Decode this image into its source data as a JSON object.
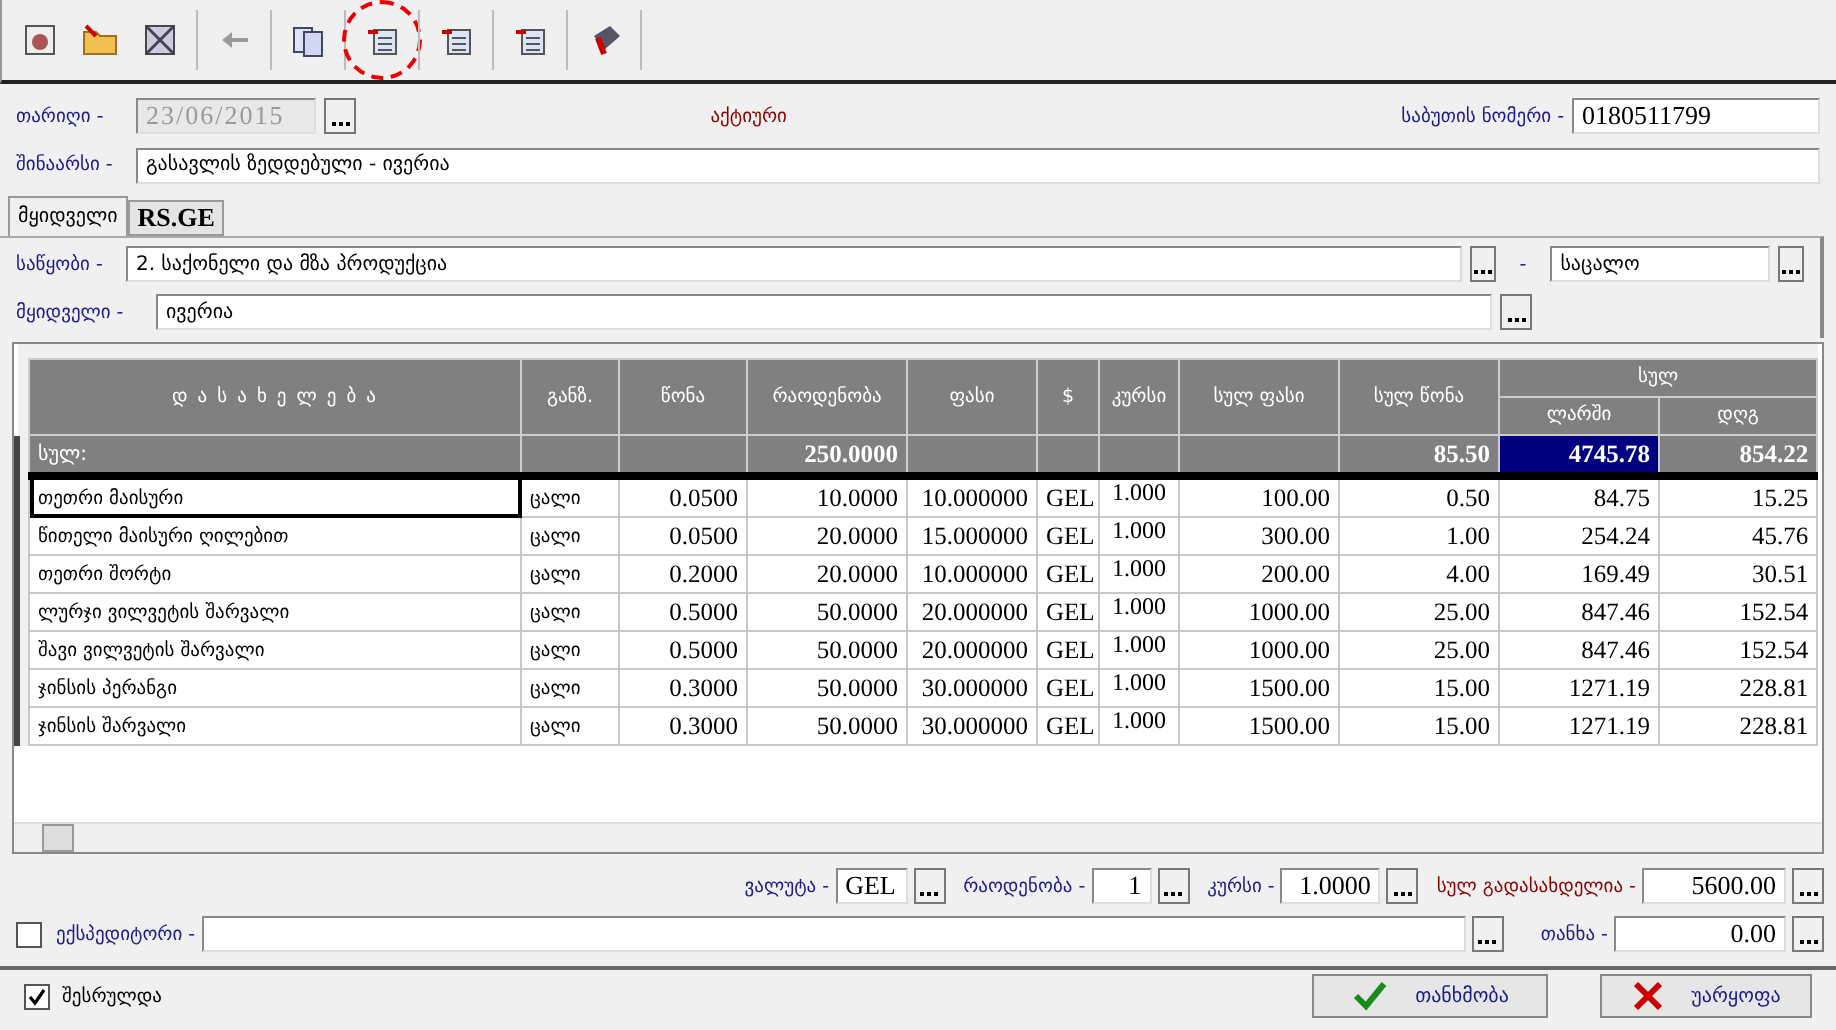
{
  "toolbar": [
    {
      "highlighted": false,
      "disabled": false
    },
    {
      "highlighted": false,
      "disabled": false
    },
    {
      "highlighted": false,
      "disabled": false
    },
    {
      "highlighted": false,
      "disabled": true
    },
    {
      "highlighted": false,
      "disabled": false
    },
    {
      "highlighted": true,
      "disabled": false
    },
    {
      "highlighted": false,
      "disabled": false
    },
    {
      "highlighted": false,
      "disabled": false
    },
    {
      "highlighted": false,
      "disabled": false
    }
  ],
  "form": {
    "date_label": "თარიღი -",
    "date": "23/06/2015",
    "date_disabled": true,
    "status": "აქტიური",
    "doc_number_label": "საბუთის ნომერი -",
    "doc_number": "0180511799",
    "content_label": "შინაარსი -",
    "content": "გასავლის ზედდებული - ივერია"
  },
  "tabs": [
    {
      "label": "მყიდველი",
      "selected": true
    },
    {
      "label": "RS.GE",
      "selected": false
    }
  ],
  "panel": {
    "warehouse_label": "საწყობი -",
    "warehouse": "2. საქონელი და მზა პროდუქცია",
    "separator": "-",
    "warehouse_type": "საცალო",
    "buyer_label": "მყიდველი -",
    "buyer": "ივერია"
  },
  "table": {
    "columns": [
      "დ ა ს ა ხ ე ლ ე ბ ა",
      "განზ.",
      "წონა",
      "რაოდენობა",
      "ფასი",
      "$",
      "კურსი",
      "სულ ფასი",
      "სულ წონა"
    ],
    "group": {
      "label": "სულ",
      "columns": [
        "ლარში",
        "დღგ"
      ]
    },
    "totals": {
      "label": "სულ:",
      "quantity": "250.0000",
      "total_weight": "85.50",
      "gel": "4745.78",
      "vat": "854.22",
      "gel_selected": true
    },
    "rows": [
      {
        "name": "თეთრი მაისური",
        "unit": "ცალი",
        "weight": "0.0500",
        "quantity": "10.0000",
        "price": "10.000000",
        "currency": "GEL",
        "rate": "1.000",
        "total_price": "100.00",
        "total_weight": "0.50",
        "gel": "84.75",
        "vat": "15.25",
        "focused": true
      },
      {
        "name": "წითელი მაისური ღილებით",
        "unit": "ცალი",
        "weight": "0.0500",
        "quantity": "20.0000",
        "price": "15.000000",
        "currency": "GEL",
        "rate": "1.000",
        "total_price": "300.00",
        "total_weight": "1.00",
        "gel": "254.24",
        "vat": "45.76",
        "focused": false
      },
      {
        "name": "თეთრი შორტი",
        "unit": "ცალი",
        "weight": "0.2000",
        "quantity": "20.0000",
        "price": "10.000000",
        "currency": "GEL",
        "rate": "1.000",
        "total_price": "200.00",
        "total_weight": "4.00",
        "gel": "169.49",
        "vat": "30.51",
        "focused": false
      },
      {
        "name": "ლურჯი ვილვეტის შარვალი",
        "unit": "ცალი",
        "weight": "0.5000",
        "quantity": "50.0000",
        "price": "20.000000",
        "currency": "GEL",
        "rate": "1.000",
        "total_price": "1000.00",
        "total_weight": "25.00",
        "gel": "847.46",
        "vat": "152.54",
        "focused": false
      },
      {
        "name": "შავი ვილვეტის შარვალი",
        "unit": "ცალი",
        "weight": "0.5000",
        "quantity": "50.0000",
        "price": "20.000000",
        "currency": "GEL",
        "rate": "1.000",
        "total_price": "1000.00",
        "total_weight": "25.00",
        "gel": "847.46",
        "vat": "152.54",
        "focused": false
      },
      {
        "name": "ჯინსის პერანგი",
        "unit": "ცალი",
        "weight": "0.3000",
        "quantity": "50.0000",
        "price": "30.000000",
        "currency": "GEL",
        "rate": "1.000",
        "total_price": "1500.00",
        "total_weight": "15.00",
        "gel": "1271.19",
        "vat": "228.81",
        "focused": false
      },
      {
        "name": "ჯინსის შარვალი",
        "unit": "ცალი",
        "weight": "0.3000",
        "quantity": "50.0000",
        "price": "30.000000",
        "currency": "GEL",
        "rate": "1.000",
        "total_price": "1500.00",
        "total_weight": "15.00",
        "gel": "1271.19",
        "vat": "228.81",
        "focused": false
      }
    ]
  },
  "summary": {
    "currency_label": "ვალუტა -",
    "currency": "GEL",
    "quantity_label": "რაოდენობა -",
    "quantity": "1",
    "rate_label": "კურსი -",
    "rate": "1.0000",
    "total_label": "სულ გადასახდელია -",
    "total": "5600.00"
  },
  "forwarder": {
    "checked": false,
    "label": "ექსპედიტორი -",
    "amount_label": "თანხა -",
    "amount": "0.00"
  },
  "footer": {
    "done": {
      "checked": true,
      "label": "შესრულდა"
    },
    "buttons": [
      {
        "kind": "ok",
        "label": "თანხმობა"
      },
      {
        "kind": "cancel",
        "label": "უარყოფა"
      }
    ]
  }
}
